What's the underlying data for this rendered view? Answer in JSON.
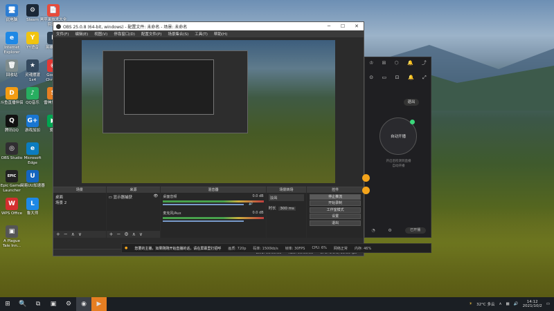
{
  "desktop": {
    "icons": [
      {
        "label": "此电脑",
        "glyph": "🖥",
        "color": "#2d7dd2"
      },
      {
        "label": "Steam",
        "glyph": "⚙",
        "color": "#1b2838"
      },
      {
        "label": "黑苹果技术大全\n剪辑版",
        "glyph": "📄",
        "color": "#e74c3c"
      },
      {
        "label": "Internet\nExplorer",
        "glyph": "e",
        "color": "#1e88e5"
      },
      {
        "label": "YY语音",
        "glyph": "Y",
        "color": "#f1c40f"
      },
      {
        "label": "英雄联盟",
        "glyph": "L",
        "color": "#2c3e50"
      },
      {
        "label": "回收站",
        "glyph": "🗑",
        "color": "#7f8c8d"
      },
      {
        "label": "灵魂摆渡\n1x4",
        "glyph": "★",
        "color": "#34495e"
      },
      {
        "label": "Google\nChrome",
        "glyph": "◉",
        "color": "#e53935"
      },
      {
        "label": "斗鱼直播伴侣",
        "glyph": "D",
        "color": "#f39c12"
      },
      {
        "label": "QQ音乐",
        "glyph": "♪",
        "color": "#27ae60"
      },
      {
        "label": "雷神加速器",
        "glyph": "S",
        "color": "#e67e22"
      },
      {
        "label": "腾讯QQ",
        "glyph": "Q",
        "color": "#111"
      },
      {
        "label": "游戏加加",
        "glyph": "G+",
        "color": "#1976d2"
      },
      {
        "label": "爱奇",
        "glyph": "▶",
        "color": "#00a651"
      },
      {
        "label": "OBS Studio",
        "glyph": "◎",
        "color": "#302e31"
      },
      {
        "label": "Microsoft\nEdge",
        "glyph": "e",
        "color": "#0b7cbf"
      },
      {
        "label": "Epic Games\nLauncher",
        "glyph": "EPIC",
        "color": "#222"
      },
      {
        "label": "网易UU加速器",
        "glyph": "U",
        "color": "#1565c0"
      },
      {
        "label": "WPS Office",
        "glyph": "W",
        "color": "#d32f2f"
      },
      {
        "label": "鲁大师",
        "glyph": "L",
        "color": "#1e88e5"
      },
      {
        "label": "A Plague\nTale Inn...",
        "glyph": "▣",
        "color": "#555"
      }
    ]
  },
  "obs": {
    "title": "OBS 25.0.8 (64-bit, windows) - 配置文件: 未命名 - 场景: 未命名",
    "menu": [
      "文件(F)",
      "编辑(E)",
      "视图(V)",
      "停靠窗口(D)",
      "配置文件(P)",
      "场景集合(S)",
      "工具(T)",
      "帮助(H)"
    ],
    "win_btns": [
      "─",
      "☐",
      "✕"
    ],
    "docks": {
      "scenes": {
        "title": "场景",
        "items": [
          "桌面",
          "场景 2"
        ]
      },
      "sources": {
        "title": "来源",
        "items": [
          "显示器捕获"
        ]
      },
      "mixer": {
        "title": "混音器",
        "channels": [
          {
            "name": "桌面音频",
            "db": "0.0 dB"
          },
          {
            "name": "麦克风/Aux",
            "db": "0.0 dB"
          }
        ]
      },
      "transitions": {
        "title": "场景转场",
        "type": "淡出",
        "duration_label": "时长",
        "duration": "300 ms"
      },
      "controls": {
        "title": "控件",
        "buttons": [
          "停止推流",
          "开始录制",
          "工作室模式",
          "设置",
          "退出"
        ]
      }
    },
    "status": {
      "live": "LIVE: 00:00:00",
      "rec": "REC: 00:00:00",
      "cpu": "CPU: 0.6%, 60.00 fps"
    },
    "foot_glyphs": [
      "+",
      "−",
      "∧",
      "∨"
    ]
  },
  "obs_strip": {
    "notice": "您要的主播，如果刚刚开始直播的话，请在屏幕里打招呼",
    "stats": [
      "画质: 720p",
      "码率: 1500kb/s",
      "帧率: 30FPS",
      "CPU: 6%",
      "网络正常",
      "内存: 46%"
    ]
  },
  "app": {
    "top_icons": [
      "♔",
      "⊞",
      "⬡",
      "🔔",
      "⤴"
    ],
    "toolbar_icons": [
      "⊙",
      "▭",
      "⊡",
      "🔔",
      "⤢"
    ],
    "exit_label": "退出",
    "circle_label": "自动开播",
    "hint1": "开启后检测到直播",
    "hint2": "自动开播",
    "bottom_icons": [
      "◔",
      "⚙"
    ],
    "pill_label": "已开播"
  },
  "taskbar": {
    "start": "⊞",
    "items": [
      "🔍",
      "⧉",
      "▣",
      "⚙",
      "◉",
      "▶"
    ],
    "weather": "32°C 多云",
    "time": "14:12",
    "date": "2021/10/2"
  }
}
